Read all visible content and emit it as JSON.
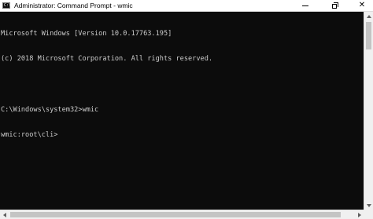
{
  "window": {
    "title": "Administrator: Command Prompt - wmic",
    "icon": "cmd-icon",
    "icon_glyph": "C:\\",
    "controls": {
      "minimize_icon": "minimize-icon",
      "restore_icon": "restore-icon",
      "close_icon": "close-icon",
      "close_glyph": "✕"
    }
  },
  "console": {
    "foreground": "#cccccc",
    "background": "#0c0c0c",
    "lines": [
      "Microsoft Windows [Version 10.0.17763.195]",
      "(c) 2018 Microsoft Corporation. All rights reserved.",
      "",
      "C:\\Windows\\system32>wmic",
      "wmic:root\\cli>"
    ]
  },
  "scrollbars": {
    "vertical": "vertical-scrollbar",
    "horizontal": "horizontal-scrollbar"
  }
}
